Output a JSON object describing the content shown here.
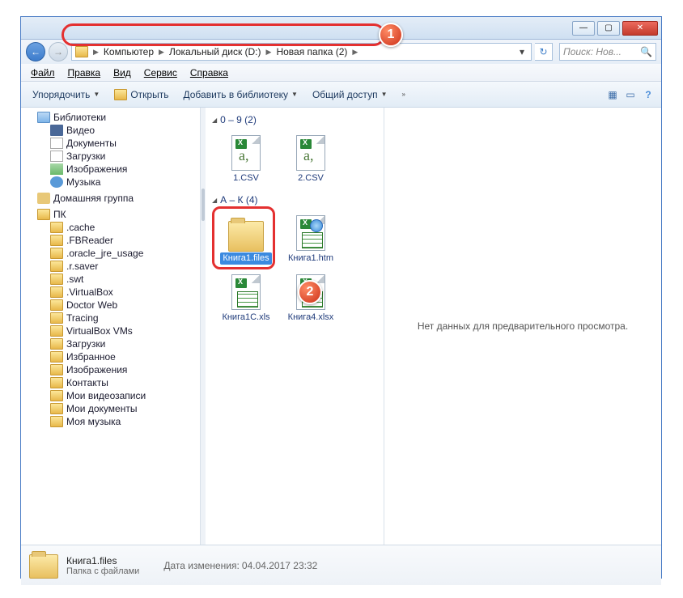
{
  "window": {
    "min": "—",
    "max": "▢",
    "close": "✕"
  },
  "breadcrumb": {
    "seg1": "Компьютер",
    "seg2": "Локальный диск (D:)",
    "seg3": "Новая папка (2)"
  },
  "search": {
    "placeholder": "Поиск: Нов..."
  },
  "menu": {
    "file": "Файл",
    "edit": "Правка",
    "view": "Вид",
    "tools": "Сервис",
    "help": "Справка"
  },
  "toolbar": {
    "organize": "Упорядочить",
    "open": "Открыть",
    "library": "Добавить в библиотеку",
    "share": "Общий доступ"
  },
  "tree": {
    "libraries": "Библиотеки",
    "video": "Видео",
    "documents": "Документы",
    "downloads": "Загрузки",
    "images": "Изображения",
    "music": "Музыка",
    "homegroup": "Домашняя группа",
    "pc": "ПК",
    "cache": ".cache",
    "fbreader": ".FBReader",
    "oracle": ".oracle_jre_usage",
    "rsaver": ".r.saver",
    "swt": ".swt",
    "vbox": ".VirtualBox",
    "drweb": "Doctor Web",
    "tracing": "Tracing",
    "vboxvm": "VirtualBox VMs",
    "downloads2": "Загрузки",
    "favorites": "Избранное",
    "images2": "Изображения",
    "contacts": "Контакты",
    "myvideos": "Мои видеозаписи",
    "mydocs": "Мои документы",
    "mymusic": "Моя музыка"
  },
  "groups": {
    "g1": "0 – 9 (2)",
    "g2": "А – К (4)"
  },
  "files": {
    "f1": "1.CSV",
    "f2": "2.CSV",
    "f3": "Книга1.files",
    "f4": "Книга1.htm",
    "f5": "Книга1С.xls",
    "f6": "Книга4.xlsx"
  },
  "preview": {
    "empty": "Нет данных для предварительного просмотра."
  },
  "status": {
    "name": "Книга1.files",
    "type": "Папка с файлами",
    "date_label": "Дата изменения:",
    "date_value": "04.04.2017 23:32"
  },
  "markers": {
    "m1": "1",
    "m2": "2"
  }
}
